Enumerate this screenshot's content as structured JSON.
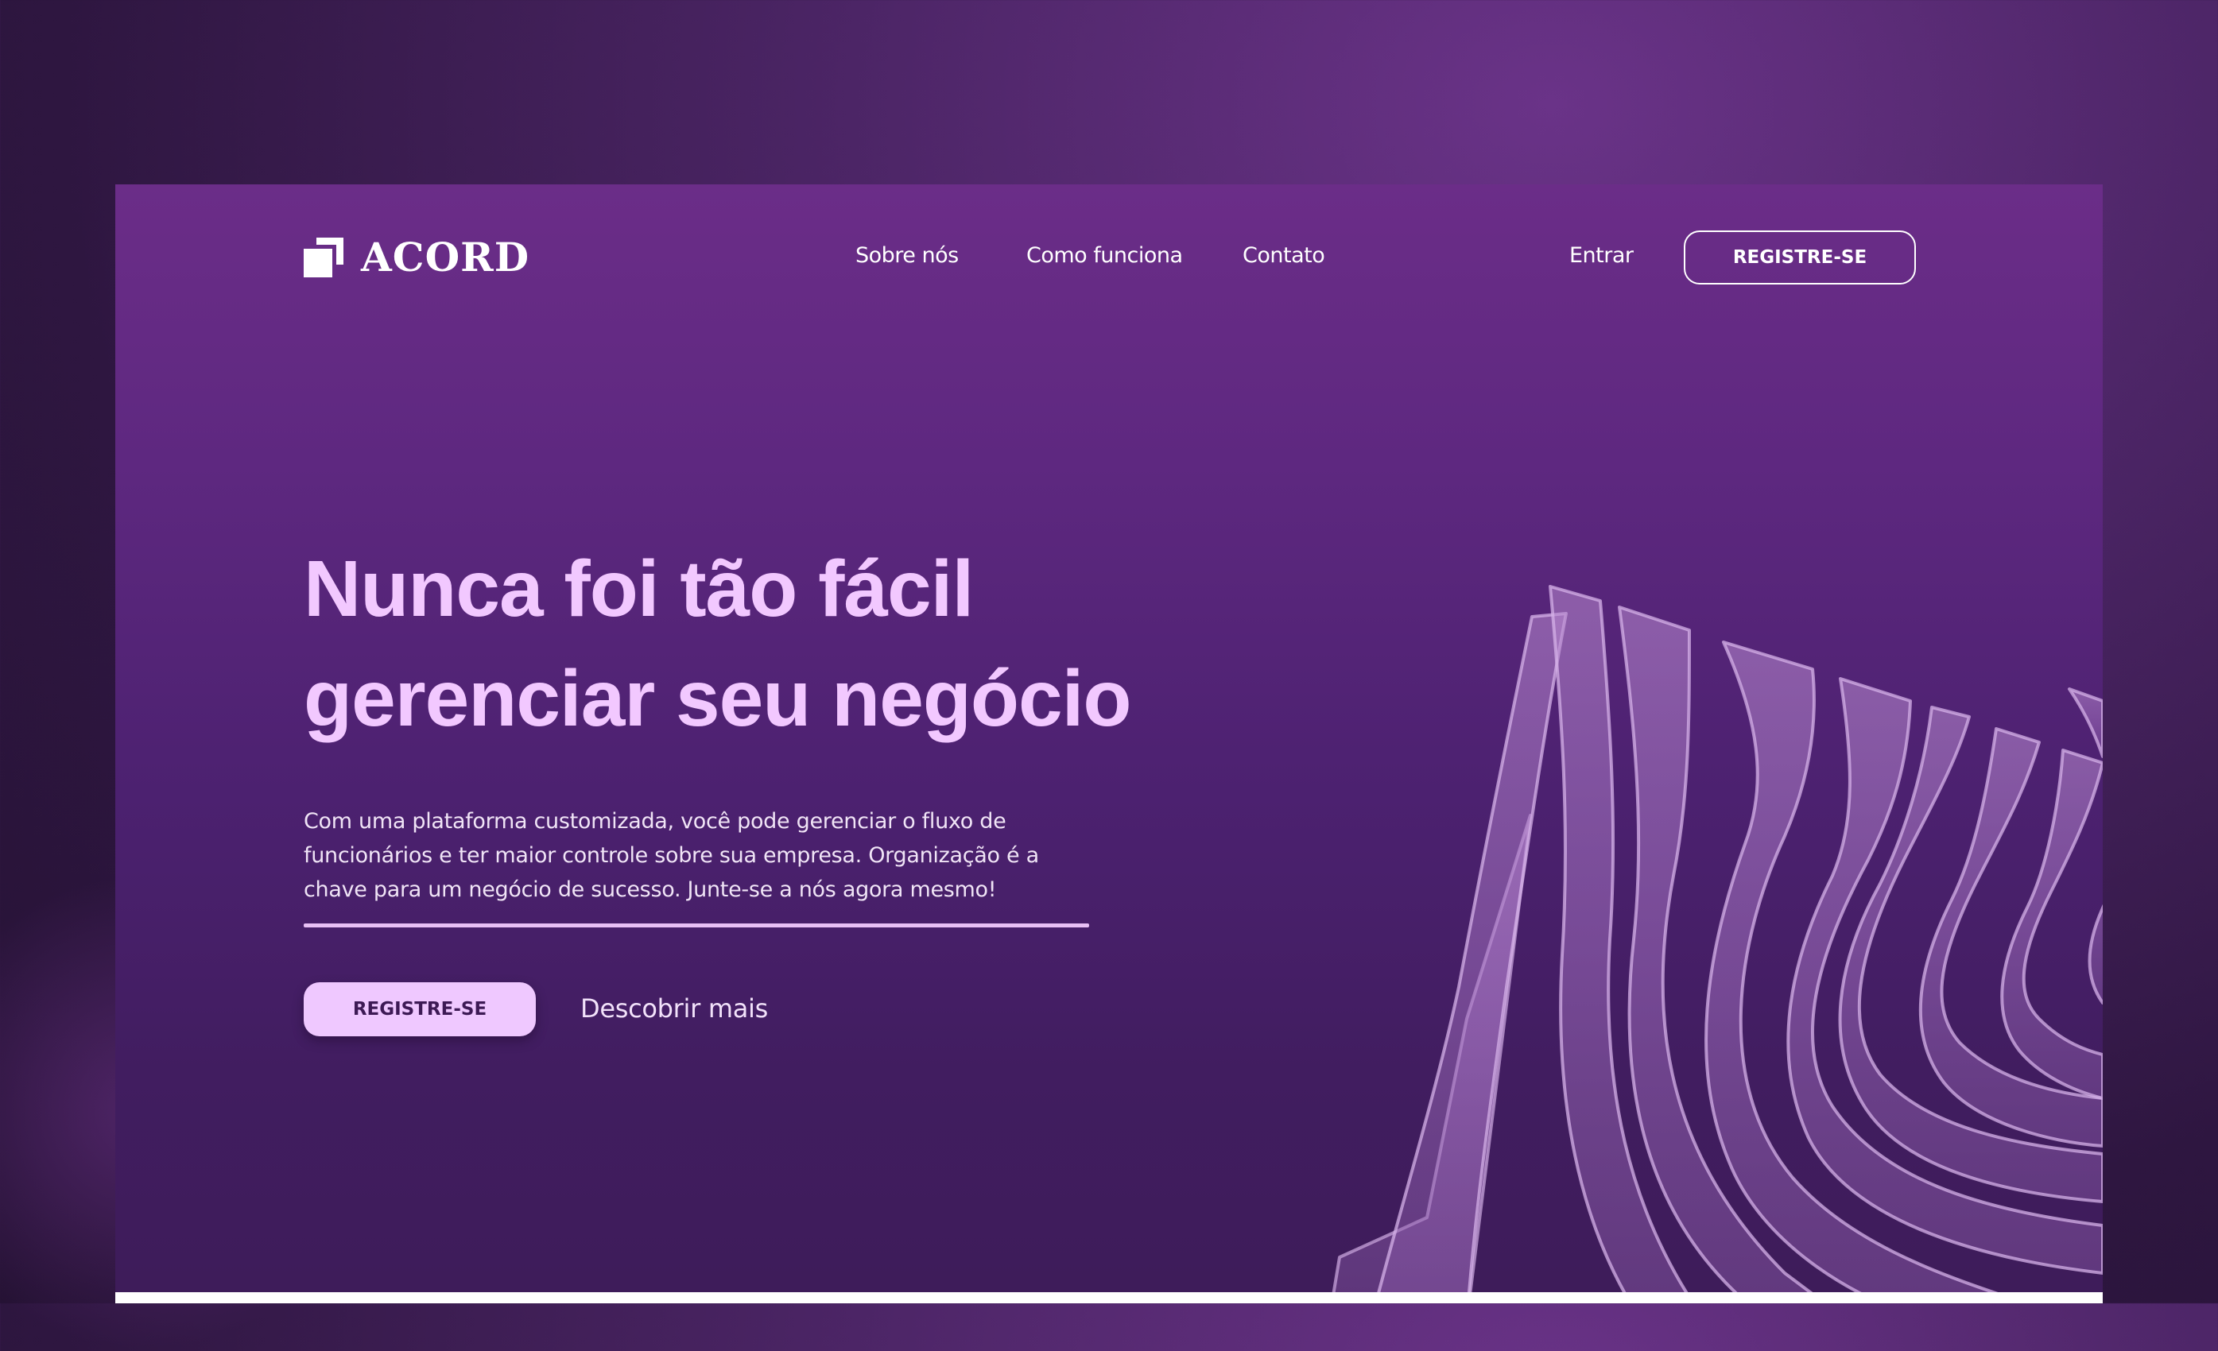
{
  "brand": {
    "name": "ACORD"
  },
  "nav": {
    "links": [
      {
        "label": "Sobre nós"
      },
      {
        "label": "Como funciona"
      },
      {
        "label": "Contato"
      }
    ],
    "login_label": "Entrar",
    "register_label": "REGISTRE-SE"
  },
  "hero": {
    "title_line1": "Nunca foi tão fácil",
    "title_line2": "gerenciar seu negócio",
    "description_line1": "Com uma plataforma customizada, você pode gerenciar o fluxo de",
    "description_line2": "funcionários e ter maior controle sobre sua empresa. Organização é a",
    "description_line3": "chave para um negócio de sucesso. Junte-se a nós agora mesmo!",
    "cta_primary_label": "REGISTRE-SE",
    "cta_secondary_label": "Descobrir mais"
  },
  "colors": {
    "background": "#2e1640",
    "card_top": "#6b2d88",
    "card_bottom": "#3e1c5a",
    "title": "#f2c8ff",
    "button_fill": "#efc8ff",
    "button_text": "#3d1a55"
  },
  "icons": {
    "logo": "acord-logo-icon",
    "art": "wavy-ribbons-illustration"
  }
}
